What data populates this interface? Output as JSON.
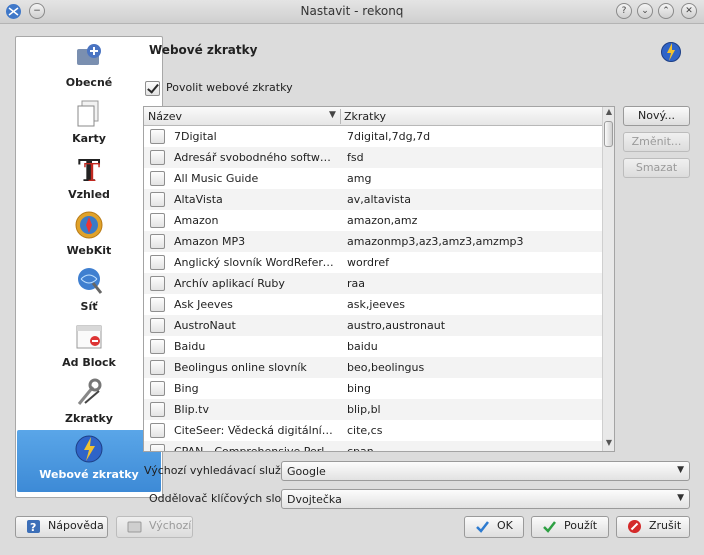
{
  "window": {
    "title": "Nastavit - rekonq",
    "controls": [
      "?",
      "⌄",
      "⌃",
      "✕"
    ]
  },
  "sidebar": {
    "items": [
      {
        "label": "Obecné",
        "icon": "general-settings-icon"
      },
      {
        "label": "Karty",
        "icon": "tabs-icon"
      },
      {
        "label": "Vzhled",
        "icon": "fonts-icon"
      },
      {
        "label": "WebKit",
        "icon": "webkit-compass-icon"
      },
      {
        "label": "Síť",
        "icon": "network-icon"
      },
      {
        "label": "Ad Block",
        "icon": "adblock-icon"
      },
      {
        "label": "Zkratky",
        "icon": "shortcuts-tools-icon"
      },
      {
        "label": "Webové zkratky",
        "icon": "web-shortcuts-icon"
      }
    ],
    "active_index": 7
  },
  "page": {
    "title": "Webové zkratky",
    "enable_label": "Povolit webové zkratky",
    "enable_checked": true
  },
  "list": {
    "col_name": "Název",
    "col_short": "Zkratky",
    "rows": [
      {
        "name": "7Digital",
        "keys": "7digital,7dg,7d"
      },
      {
        "name": "Adresář svobodného softwaru ...",
        "keys": "fsd"
      },
      {
        "name": "All Music Guide",
        "keys": "amg"
      },
      {
        "name": "AltaVista",
        "keys": "av,altavista"
      },
      {
        "name": "Amazon",
        "keys": "amazon,amz"
      },
      {
        "name": "Amazon MP3",
        "keys": "amazonmp3,az3,amz3,amzmp3"
      },
      {
        "name": "Anglický slovník WordReferenc...",
        "keys": "wordref"
      },
      {
        "name": "Archív aplikací Ruby",
        "keys": "raa"
      },
      {
        "name": "Ask Jeeves",
        "keys": "ask,jeeves"
      },
      {
        "name": "AustroNaut",
        "keys": "austro,austronaut"
      },
      {
        "name": "Baidu",
        "keys": "baidu"
      },
      {
        "name": "Beolingus online slovník",
        "keys": "beo,beolingus"
      },
      {
        "name": "Bing",
        "keys": "bing"
      },
      {
        "name": "Blip.tv",
        "keys": "blip,bl"
      },
      {
        "name": "CiteSeer: Vědecká digitální kni...",
        "keys": "cite,cs"
      },
      {
        "name": "CPAN - Comprehensive Perl Arc...",
        "keys": "cpan"
      }
    ]
  },
  "buttons": {
    "new": "Nový...",
    "change": "Změnit...",
    "delete": "Smazat"
  },
  "combos": {
    "search_label": "Výchozí vyhledávací služba:",
    "search_value": "Google",
    "delim_label": "Oddělovač klíčových slov:",
    "delim_value": "Dvojtečka"
  },
  "footer": {
    "help": "Nápověda",
    "defaults": "Výchozí",
    "ok": "OK",
    "apply": "Použít",
    "cancel": "Zrušit"
  }
}
